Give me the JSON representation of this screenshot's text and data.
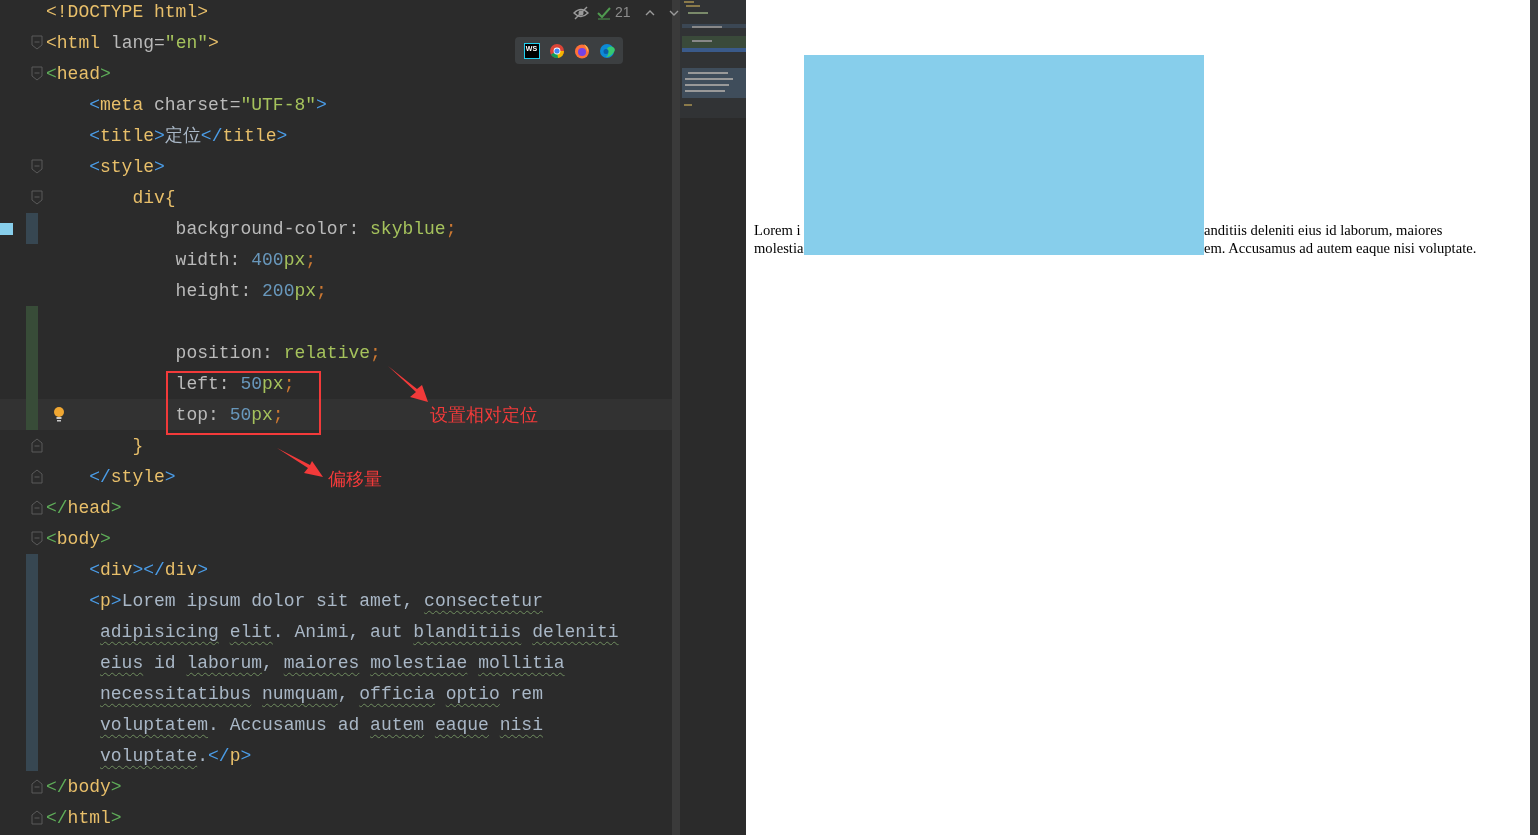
{
  "editor": {
    "inspections": {
      "count": "21"
    },
    "browser_icons": [
      {
        "kind": "webstorm",
        "label": "WS"
      },
      {
        "kind": "chrome"
      },
      {
        "kind": "firefox"
      },
      {
        "kind": "edge"
      }
    ],
    "lines": [
      {
        "tokens": [
          {
            "text": "<!DOCTYPE html>",
            "kind": "tag"
          }
        ]
      },
      {
        "fold_start": true,
        "tokens": [
          {
            "text": "<html",
            "kind": "tag"
          },
          {
            "text": " lang=",
            "kind": "attr"
          },
          {
            "text": "\"en\"",
            "kind": "string"
          },
          {
            "text": ">",
            "kind": "tag"
          }
        ]
      },
      {
        "fold_start": true,
        "tokens": [
          {
            "text": "<",
            "kind": "greenbracket"
          },
          {
            "text": "head",
            "kind": "tag"
          },
          {
            "text": ">",
            "kind": "greenbracket"
          }
        ]
      },
      {
        "tokens": [
          {
            "text": "    <",
            "kind": "bluebracket"
          },
          {
            "text": "meta",
            "kind": "tag"
          },
          {
            "text": " charset=",
            "kind": "attr"
          },
          {
            "text": "\"UTF-8\"",
            "kind": "string"
          },
          {
            "text": ">",
            "kind": "bluebracket"
          }
        ]
      },
      {
        "tokens": [
          {
            "text": "    <",
            "kind": "bluebracket"
          },
          {
            "text": "title",
            "kind": "tag"
          },
          {
            "text": ">",
            "kind": "bluebracket"
          },
          {
            "text": "定位",
            "kind": "text"
          },
          {
            "text": "</",
            "kind": "bluebracket"
          },
          {
            "text": "title",
            "kind": "tag"
          },
          {
            "text": ">",
            "kind": "bluebracket"
          }
        ]
      },
      {
        "fold_start": true,
        "tokens": [
          {
            "text": "    <",
            "kind": "bluebracket"
          },
          {
            "text": "style",
            "kind": "tag"
          },
          {
            "text": ">",
            "kind": "bluebracket"
          }
        ]
      },
      {
        "fold_start": true,
        "tokens": [
          {
            "text": "        div{",
            "kind": "tag"
          }
        ]
      },
      {
        "modified": true,
        "swatch": true,
        "tokens": [
          {
            "text": "            background-color: ",
            "kind": "prop"
          },
          {
            "text": "skyblue",
            "kind": "value"
          },
          {
            "text": ";",
            "kind": "punct"
          }
        ]
      },
      {
        "tokens": [
          {
            "text": "            width: ",
            "kind": "prop"
          },
          {
            "text": "400",
            "kind": "number"
          },
          {
            "text": "px",
            "kind": "value"
          },
          {
            "text": ";",
            "kind": "punct"
          }
        ]
      },
      {
        "tokens": [
          {
            "text": "            height: ",
            "kind": "prop"
          },
          {
            "text": "200",
            "kind": "number"
          },
          {
            "text": "px",
            "kind": "value"
          },
          {
            "text": ";",
            "kind": "punct"
          }
        ]
      },
      {
        "added": true
      },
      {
        "added": true,
        "tokens": [
          {
            "text": "            position: ",
            "kind": "prop"
          },
          {
            "text": "relative",
            "kind": "value"
          },
          {
            "text": ";",
            "kind": "punct"
          }
        ]
      },
      {
        "added": true,
        "tokens": [
          {
            "text": "            left: ",
            "kind": "prop"
          },
          {
            "text": "50",
            "kind": "number"
          },
          {
            "text": "px",
            "kind": "value"
          },
          {
            "text": ";",
            "kind": "punct"
          }
        ]
      },
      {
        "added": true,
        "current": true,
        "bulb": true,
        "tokens": [
          {
            "text": "            top: ",
            "kind": "prop"
          },
          {
            "text": "50",
            "kind": "number"
          },
          {
            "text": "px",
            "kind": "value"
          },
          {
            "text": ";",
            "kind": "punct"
          }
        ]
      },
      {
        "fold_end": true,
        "tokens": [
          {
            "text": "        }",
            "kind": "tag"
          }
        ]
      },
      {
        "fold_end": true,
        "tokens": [
          {
            "text": "    </",
            "kind": "bluebracket"
          },
          {
            "text": "style",
            "kind": "tag"
          },
          {
            "text": ">",
            "kind": "bluebracket"
          }
        ]
      },
      {
        "fold_end": true,
        "tokens": [
          {
            "text": "</",
            "kind": "greenbracket"
          },
          {
            "text": "head",
            "kind": "tag"
          },
          {
            "text": ">",
            "kind": "greenbracket"
          }
        ]
      },
      {
        "fold_start": true,
        "tokens": [
          {
            "text": "<",
            "kind": "greenbracket"
          },
          {
            "text": "body",
            "kind": "tag"
          },
          {
            "text": ">",
            "kind": "greenbracket"
          }
        ]
      },
      {
        "modified": true,
        "tokens": [
          {
            "text": "    <",
            "kind": "bluebracket"
          },
          {
            "text": "div",
            "kind": "tag"
          },
          {
            "text": "></",
            "kind": "bluebracket"
          },
          {
            "text": "div",
            "kind": "tag"
          },
          {
            "text": ">",
            "kind": "bluebracket"
          }
        ]
      },
      {
        "modified": true,
        "tokens": [
          {
            "text": "    <",
            "kind": "bluebracket"
          },
          {
            "text": "p",
            "kind": "tag"
          },
          {
            "text": ">",
            "kind": "bluebracket"
          },
          {
            "text": "Lorem ipsum dolor sit amet,",
            "kind": "text"
          },
          {
            "text": " consectetur",
            "kind": "typo"
          }
        ]
      },
      {
        "modified": true,
        "tokens": [
          {
            "text": "     adipisicing",
            "kind": "typo"
          },
          {
            "text": " elit",
            "kind": "typo"
          },
          {
            "text": ". Animi, aut",
            "kind": "text"
          },
          {
            "text": " blanditiis",
            "kind": "typo"
          },
          {
            "text": " deleniti",
            "kind": "typo"
          }
        ]
      },
      {
        "modified": true,
        "tokens": [
          {
            "text": "     eius",
            "kind": "typo"
          },
          {
            "text": " id",
            "kind": "text"
          },
          {
            "text": " laborum",
            "kind": "typo"
          },
          {
            "text": ",",
            "kind": "text"
          },
          {
            "text": " maiores",
            "kind": "typo"
          },
          {
            "text": " molestiae",
            "kind": "typo"
          },
          {
            "text": " mollitia",
            "kind": "typo"
          }
        ]
      },
      {
        "modified": true,
        "tokens": [
          {
            "text": "     necessitatibus",
            "kind": "typo"
          },
          {
            "text": " numquam",
            "kind": "typo"
          },
          {
            "text": ",",
            "kind": "text"
          },
          {
            "text": " officia",
            "kind": "typo"
          },
          {
            "text": " optio",
            "kind": "typo"
          },
          {
            "text": " rem",
            "kind": "text"
          }
        ]
      },
      {
        "modified": true,
        "tokens": [
          {
            "text": "     voluptatem",
            "kind": "typo"
          },
          {
            "text": ". Accusamus ad",
            "kind": "text"
          },
          {
            "text": " autem",
            "kind": "typo"
          },
          {
            "text": " eaque",
            "kind": "typo"
          },
          {
            "text": " nisi",
            "kind": "typo"
          }
        ]
      },
      {
        "modified": true,
        "tokens": [
          {
            "text": "     voluptate",
            "kind": "typo"
          },
          {
            "text": ".",
            "kind": "text"
          },
          {
            "text": "</",
            "kind": "bluebracket"
          },
          {
            "text": "p",
            "kind": "tag"
          },
          {
            "text": ">",
            "kind": "bluebracket"
          }
        ]
      },
      {
        "fold_end": true,
        "tokens": [
          {
            "text": "</",
            "kind": "greenbracket"
          },
          {
            "text": "body",
            "kind": "tag"
          },
          {
            "text": ">",
            "kind": "greenbracket"
          }
        ]
      },
      {
        "fold_end": true,
        "tokens": [
          {
            "text": "</",
            "kind": "greenbracket"
          },
          {
            "text": "html",
            "kind": "tag"
          },
          {
            "text": ">",
            "kind": "greenbracket"
          }
        ]
      }
    ],
    "annotations": [
      {
        "label": "设置相对定位"
      },
      {
        "label": "偏移量"
      }
    ]
  },
  "preview": {
    "left_fragments": [
      "Lorem i",
      "molestia"
    ],
    "right_fragments": [
      "anditiis deleniti eius id laborum, maiores",
      "em. Accusamus ad autem eaque nisi voluptate."
    ]
  }
}
